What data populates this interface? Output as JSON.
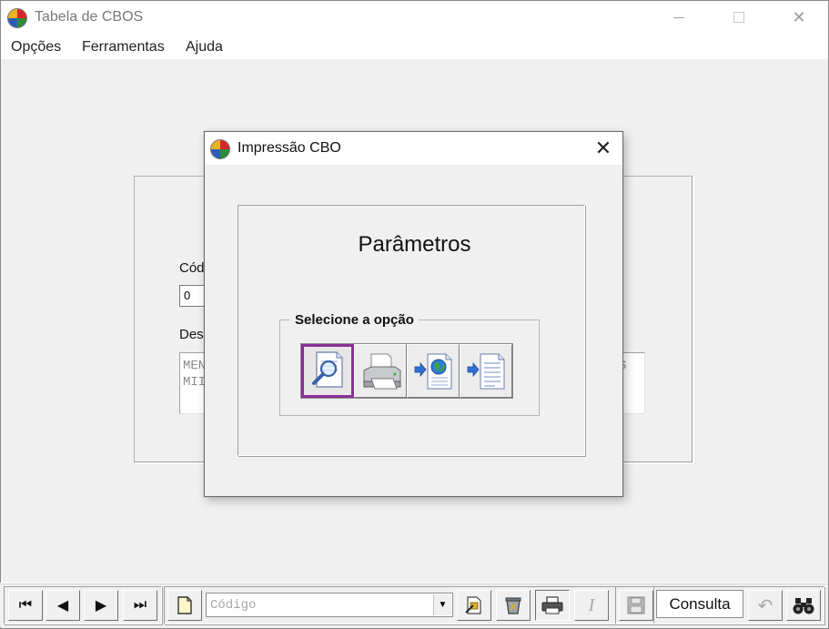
{
  "window": {
    "title": "Tabela de CBOS",
    "controls": {
      "minimize": "—",
      "maximize": "□",
      "close": "✕"
    }
  },
  "menu": {
    "items": [
      "Opções",
      "Ferramentas",
      "Ajuda"
    ]
  },
  "form": {
    "code_label": "Cód",
    "code_value": "0",
    "desc_label": "Des",
    "desc_lines": [
      "MEN",
      "MII"
    ],
    "desc_right_text": "S"
  },
  "dialog": {
    "title": "Impressão CBO",
    "close": "✕",
    "heading": "Parâmetros",
    "group_label": "Selecione a opção",
    "options": [
      {
        "icon": "preview-icon",
        "selected": true
      },
      {
        "icon": "printer-icon",
        "selected": false
      },
      {
        "icon": "export-html-icon",
        "selected": false
      },
      {
        "icon": "export-text-icon",
        "selected": false
      }
    ]
  },
  "toolbar": {
    "nav": {
      "first": "⏮",
      "prev": "◀",
      "next": "▶",
      "last": "⏭"
    },
    "search_placeholder": "Código",
    "combo_arrow": "▼",
    "edit_italic": "I",
    "mode": "Consulta",
    "undo": "↶"
  },
  "colors": {
    "selected_border": "#8a2f98",
    "window_bg": "#f0f0f0"
  }
}
